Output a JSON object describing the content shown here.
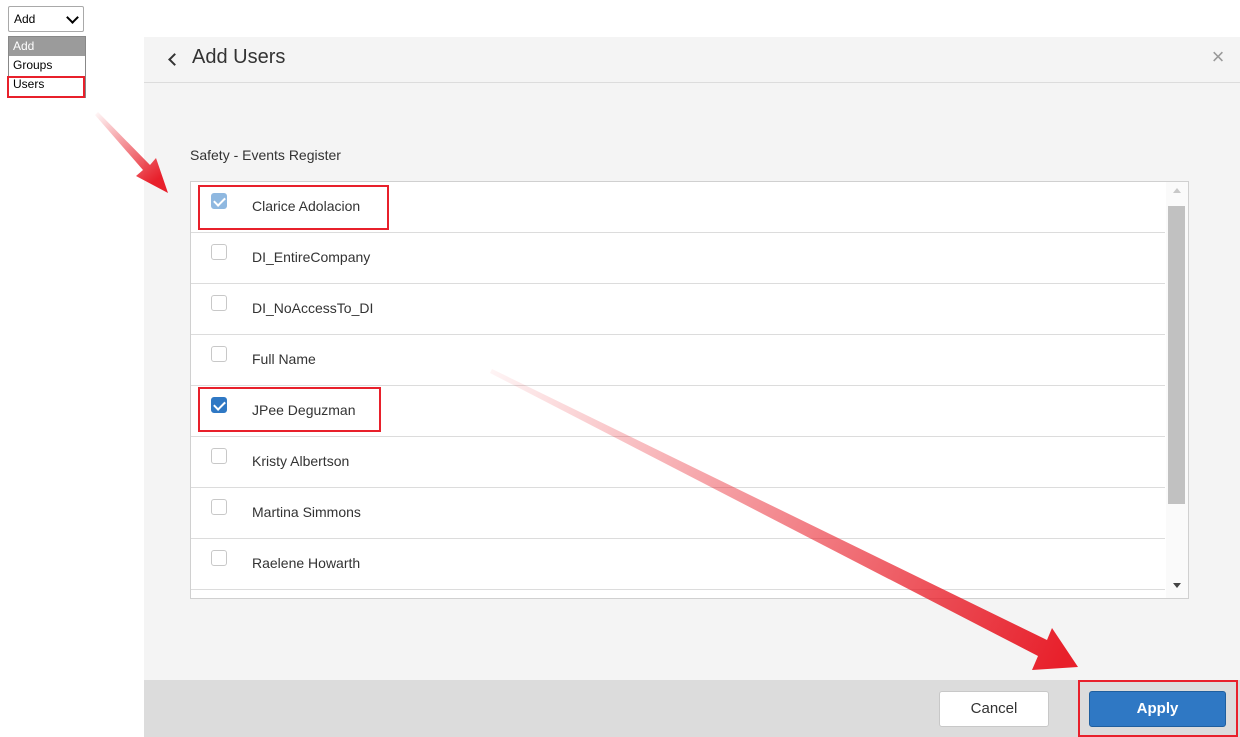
{
  "dropdown": {
    "value": "Add",
    "options": [
      "Add",
      "Groups",
      "Users"
    ]
  },
  "modal": {
    "title": "Add Users",
    "close_glyph": "×",
    "section_label": "Safety - Events Register",
    "items": [
      {
        "label": "Clarice Adolacion",
        "checked": true
      },
      {
        "label": "DI_EntireCompany",
        "checked": false
      },
      {
        "label": "DI_NoAccessTo_DI",
        "checked": false
      },
      {
        "label": "Full Name",
        "checked": false
      },
      {
        "label": "JPee Deguzman",
        "checked": true
      },
      {
        "label": "Kristy Albertson",
        "checked": false
      },
      {
        "label": "Martina Simmons",
        "checked": false
      },
      {
        "label": "Raelene Howarth",
        "checked": false
      }
    ],
    "footer": {
      "cancel_label": "Cancel",
      "apply_label": "Apply"
    }
  },
  "colors": {
    "accent": "#2f78c4",
    "annotation": "#e8202b"
  },
  "icons": {
    "back": "chevron-left-icon",
    "close": "close-icon",
    "dropdown": "chevron-down-icon"
  }
}
